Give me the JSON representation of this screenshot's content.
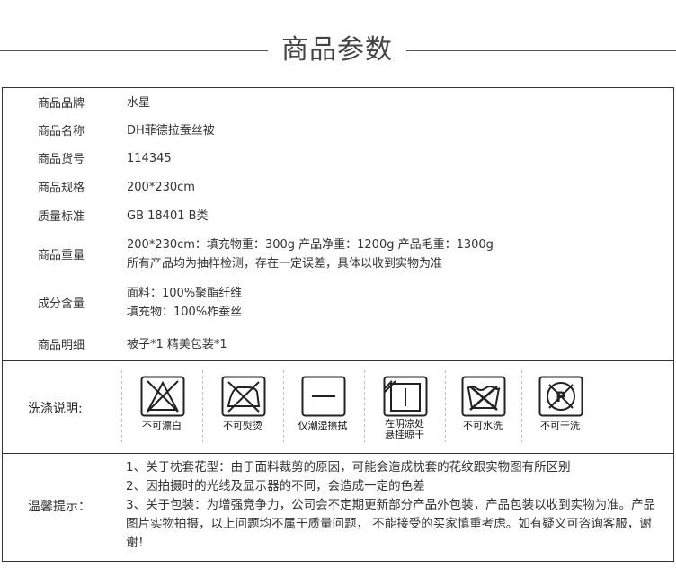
{
  "header": {
    "title": "商品参数"
  },
  "params": [
    {
      "label": "商品品牌",
      "value": "水星"
    },
    {
      "label": "商品名称",
      "value": "DH菲德拉蚕丝被"
    },
    {
      "label": "商品货号",
      "value": "114345"
    },
    {
      "label": "商品规格",
      "value": "200*230cm"
    },
    {
      "label": "质量标准",
      "value": "GB 18401 B类"
    },
    {
      "label": "商品重量",
      "value": "200*230cm：填充物重：300g 产品净重：1200g 产品毛重：1300g",
      "value2": "所有产品均为抽样检测，存在一定误差，具体以收到实物为准"
    },
    {
      "label": "成分含量",
      "value": "面料：100%聚酯纤维",
      "value2": "填充物：100%柞蚕丝"
    },
    {
      "label": "商品明细",
      "value": "被子*1 精美包装*1"
    }
  ],
  "wash": {
    "label": "洗涤说明:",
    "items": [
      {
        "icon": "no-bleach-icon",
        "caption": "不可漂白"
      },
      {
        "icon": "no-iron-icon",
        "caption": "不可熨烫"
      },
      {
        "icon": "damp-wipe-icon",
        "caption": "仅潮湿擦拭"
      },
      {
        "icon": "line-dry-shade-icon",
        "caption": "在阴凉处",
        "caption2": "悬挂晾干"
      },
      {
        "icon": "no-wash-icon",
        "caption": "不可水洗"
      },
      {
        "icon": "no-dry-clean-icon",
        "caption": "不可干洗"
      }
    ]
  },
  "tips": {
    "label": "温馨提示：",
    "lines": [
      "1、关于枕套花型：由于面料裁剪的原因，可能会造成枕套的花纹跟实物图有所区别",
      "2、因拍摄时的光线及显示器的不同，会造成一定的色差",
      "3、关于包装：为增强竞争力，公司会不定期更新部分产品外包装，产品包装以收到实物为准。产品图片实物拍摄，以上问题均不属于质量问题， 不能接受的买家慎重考虑。如有疑义可咨询客服，谢谢！"
    ]
  },
  "colors": {
    "border": "#333333",
    "text": "#333333",
    "icon_box": "#222222"
  }
}
